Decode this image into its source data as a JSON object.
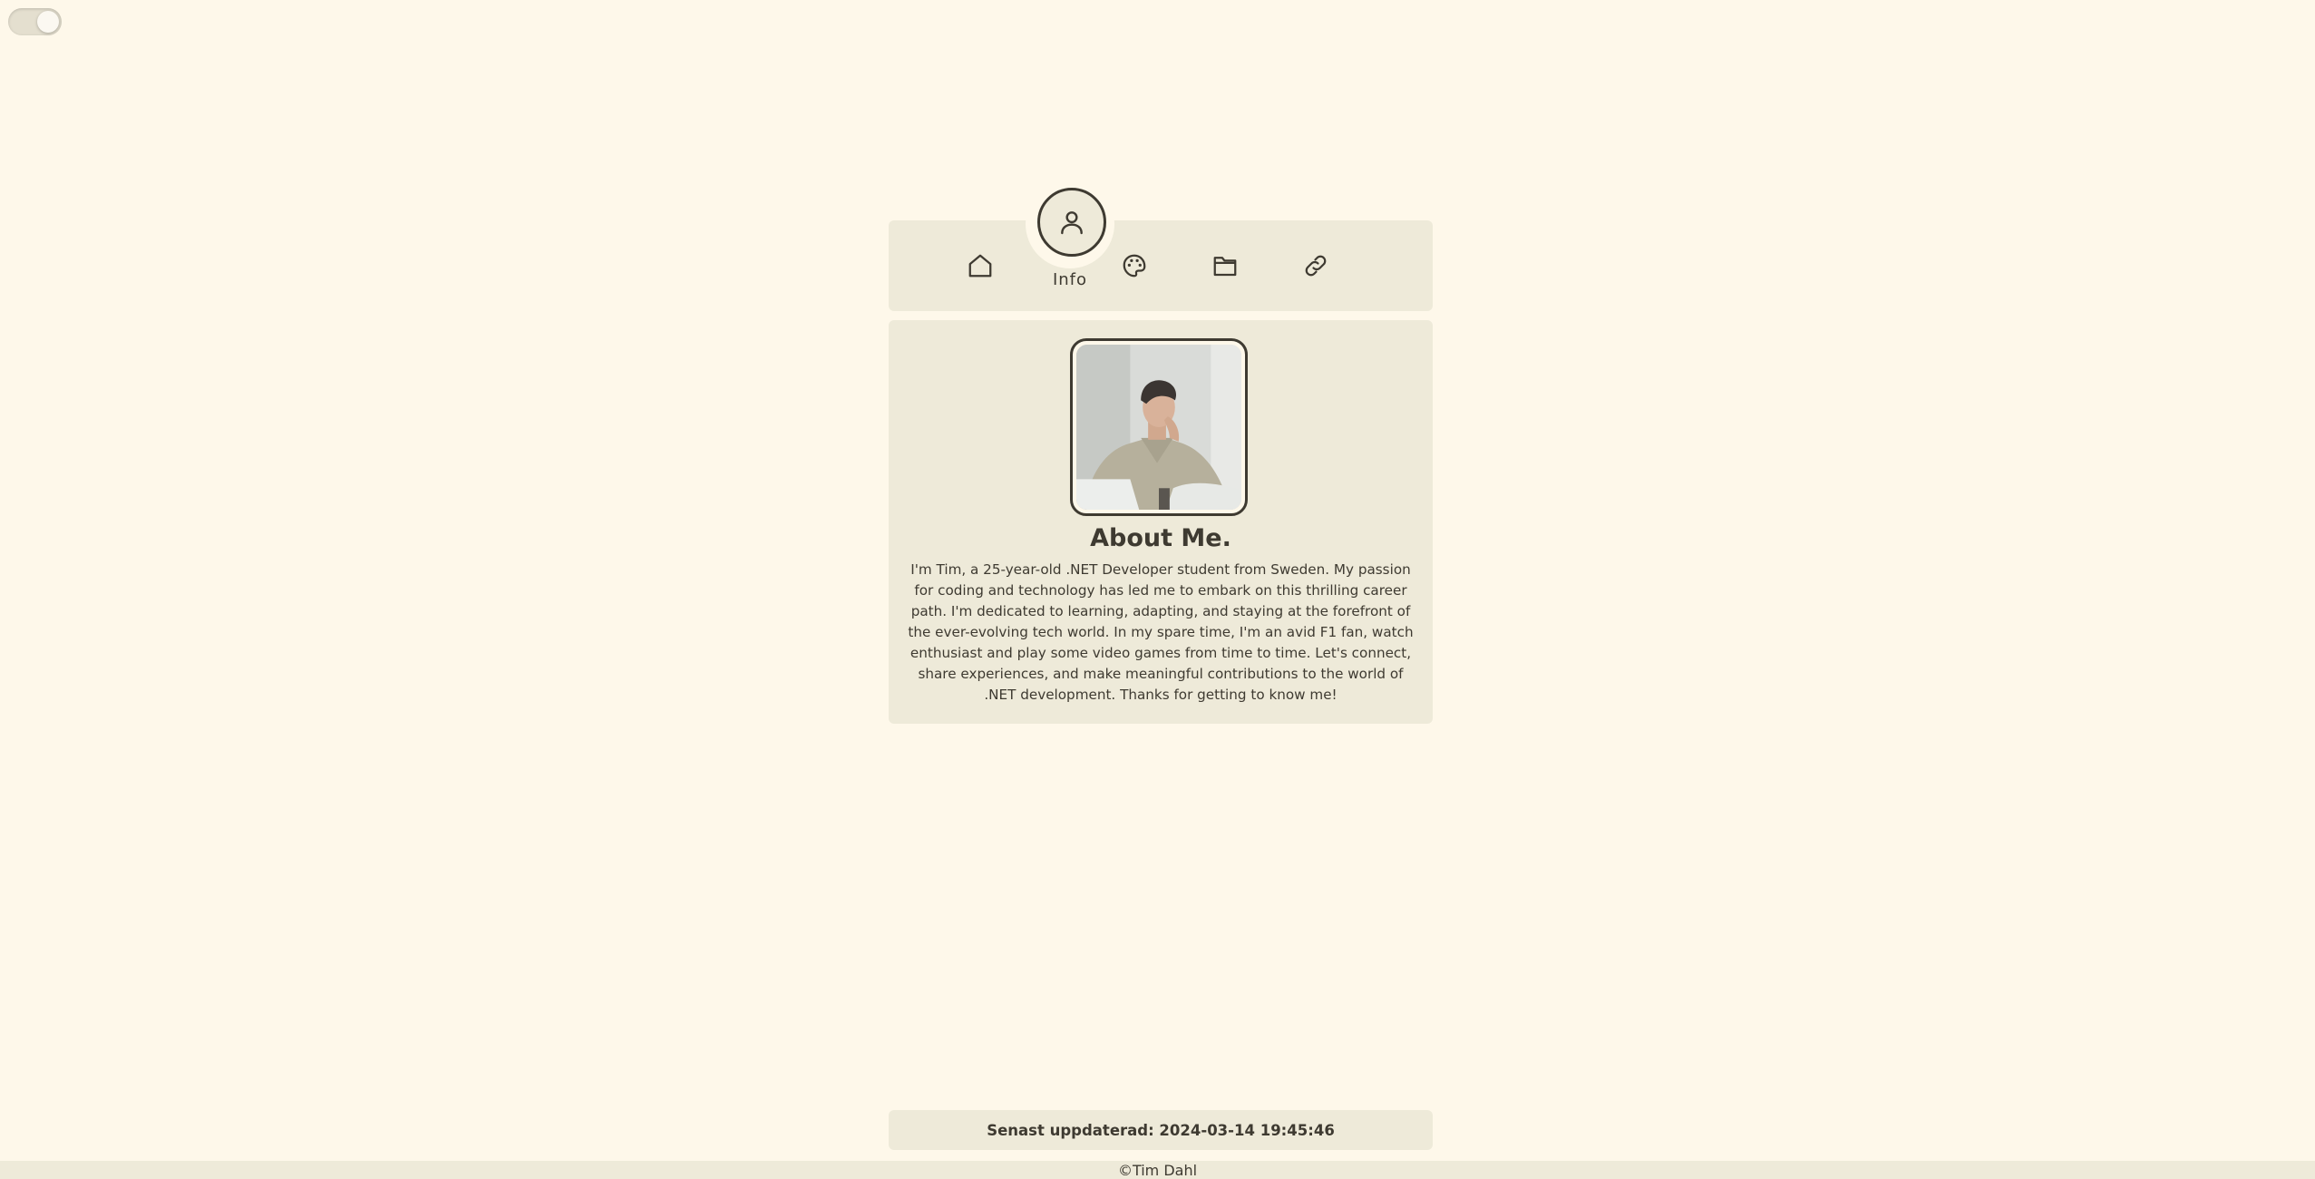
{
  "theme_toggle": {
    "icon": "toggle-switch"
  },
  "nav": {
    "items": [
      {
        "icon": "home-icon"
      },
      {
        "icon": "user-icon",
        "label": "Info",
        "active": true
      },
      {
        "icon": "palette-icon"
      },
      {
        "icon": "folder-icon"
      },
      {
        "icon": "link-icon"
      }
    ]
  },
  "about": {
    "photo_alt": "Tim",
    "title": "About Me.",
    "text": "I'm Tim, a 25-year-old .NET Developer student from Sweden. My passion for coding and technology has led me to embark on this thrilling career path. I'm dedicated to learning, adapting, and staying at the forefront of the ever-evolving tech world. In my spare time, I'm an avid F1 fan, watch enthusiast and play some video games from time to time. Let's connect, share experiences, and make meaningful contributions to the world of .NET development. Thanks for getting to know me!"
  },
  "updated": {
    "text": "Senast uppdaterad: 2024-03-14 19:45:46"
  },
  "footer": {
    "text": "©Tim Dahl"
  },
  "colors": {
    "background": "#fef8ea",
    "panel": "#eeead9",
    "text": "#3e3a31"
  }
}
